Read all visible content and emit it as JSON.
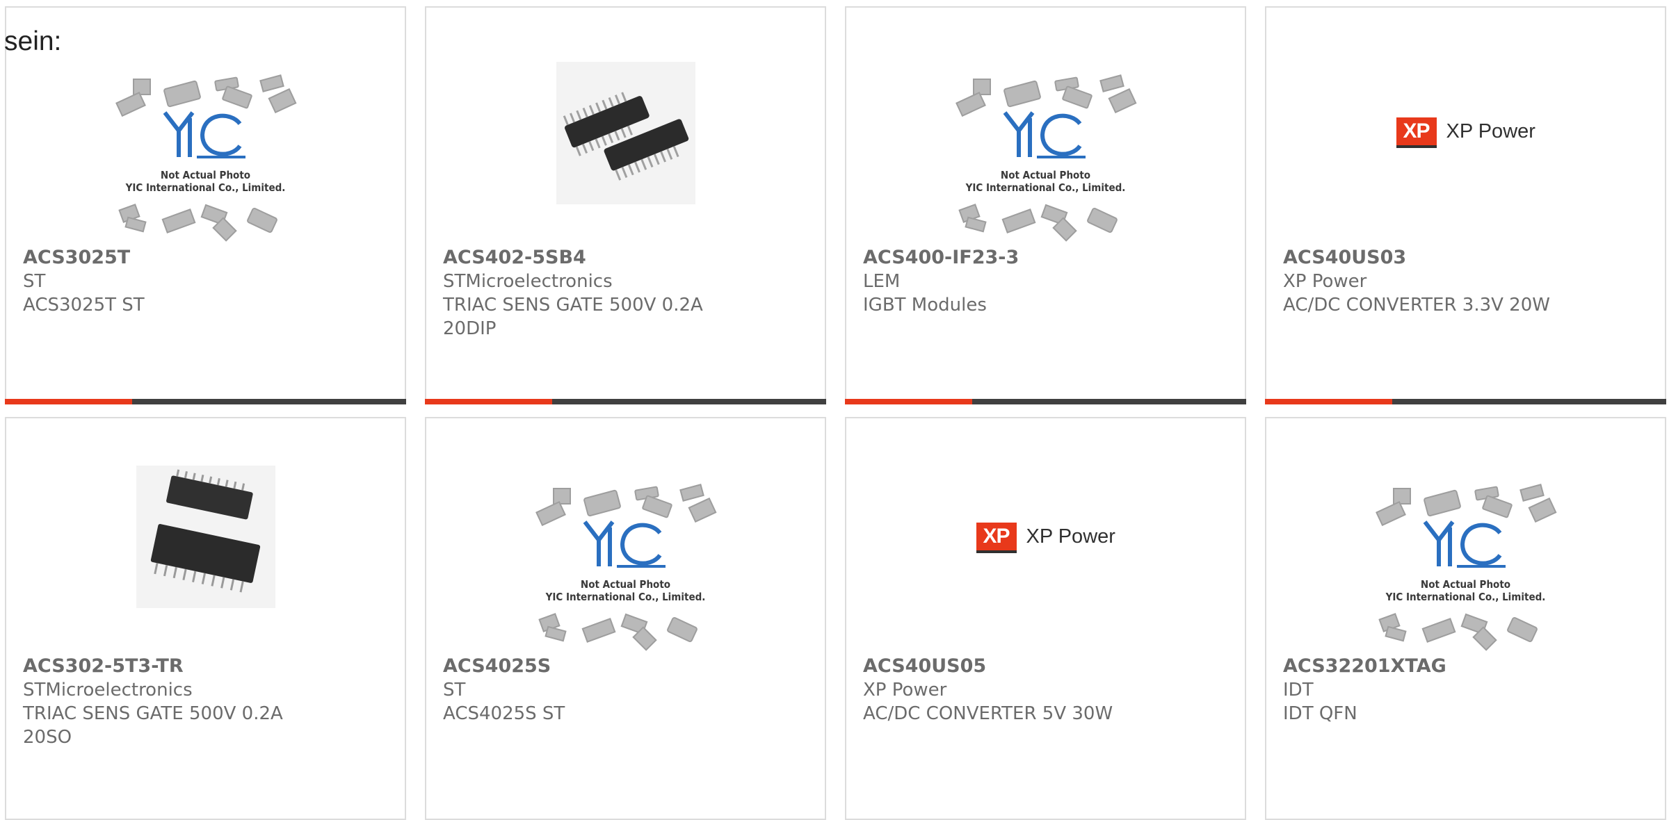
{
  "intro_text": "sein:",
  "placeholder_note": {
    "line1": "Not Actual Photo",
    "line2": "YIC International Co., Limited."
  },
  "xp_logo": {
    "mark": "XP",
    "word": "XP Power"
  },
  "colors": {
    "accent": "#e8391b",
    "bar": "#404040",
    "border": "#dcdcdc",
    "text": "#6b6b6b"
  },
  "products": [
    {
      "part": "ACS3025T",
      "maker": "ST",
      "desc": "ACS3025T ST",
      "image": "yic-placeholder"
    },
    {
      "part": "ACS402-5SB4",
      "maker": "STMicroelectronics",
      "desc": "TRIAC SENS GATE 500V 0.2A 20DIP",
      "image": "dip-chip-photo"
    },
    {
      "part": "ACS400-IF23-3",
      "maker": "LEM",
      "desc": "IGBT Modules",
      "image": "yic-placeholder"
    },
    {
      "part": "ACS40US03",
      "maker": "XP Power",
      "desc": "AC/DC CONVERTER 3.3V 20W",
      "image": "xp-power-logo"
    },
    {
      "part": "ACS302-5T3-TR",
      "maker": "STMicroelectronics",
      "desc": "TRIAC SENS GATE 500V 0.2A 20SO",
      "image": "so-chip-photo"
    },
    {
      "part": "ACS4025S",
      "maker": "ST",
      "desc": "ACS4025S ST",
      "image": "yic-placeholder"
    },
    {
      "part": "ACS40US05",
      "maker": "XP Power",
      "desc": "AC/DC CONVERTER 5V 30W",
      "image": "xp-power-logo"
    },
    {
      "part": "ACS32201XTAG",
      "maker": "IDT",
      "desc": "IDT QFN",
      "image": "yic-placeholder"
    }
  ]
}
